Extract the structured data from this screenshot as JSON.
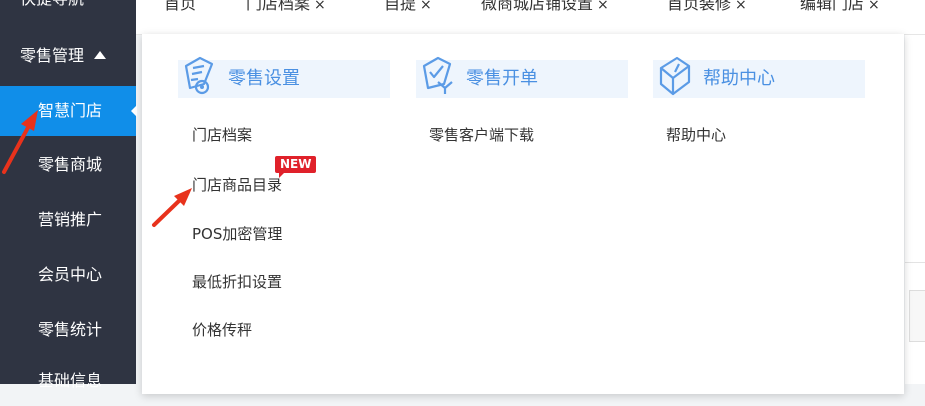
{
  "sidebar": {
    "quick_nav": "快捷导航",
    "group_label": "零售管理",
    "items": [
      {
        "label": "智慧门店",
        "active": true
      },
      {
        "label": "零售商城"
      },
      {
        "label": "营销推广"
      },
      {
        "label": "会员中心"
      },
      {
        "label": "零售统计"
      },
      {
        "label": "基础信息"
      }
    ]
  },
  "tabs": [
    {
      "label": "首页",
      "closable": false
    },
    {
      "label": "门店档案",
      "closable": true
    },
    {
      "label": "自提",
      "closable": true
    },
    {
      "label": "微商城店铺设置",
      "closable": true
    },
    {
      "label": "首页装修",
      "closable": true
    },
    {
      "label": "编辑门店",
      "closable": true
    }
  ],
  "close_glyph": "×",
  "menu": {
    "columns": [
      {
        "title": "零售设置",
        "icon": "retail-settings-icon",
        "links": [
          "门店档案",
          "门店商品目录",
          "POS加密管理",
          "最低折扣设置",
          "价格传秤"
        ]
      },
      {
        "title": "零售开单",
        "icon": "retail-order-icon",
        "links": [
          "零售客户端下载"
        ]
      },
      {
        "title": "帮助中心",
        "icon": "help-book-icon",
        "links": [
          "帮助中心"
        ]
      }
    ],
    "new_badge": "NEW"
  },
  "colors": {
    "sidebar_bg": "#2f3442",
    "active_blue": "#108ee9",
    "header_bg": "#eef5fd",
    "header_text": "#4a90e2",
    "badge_red": "#e0212a",
    "annotation_red": "#e8321c"
  }
}
